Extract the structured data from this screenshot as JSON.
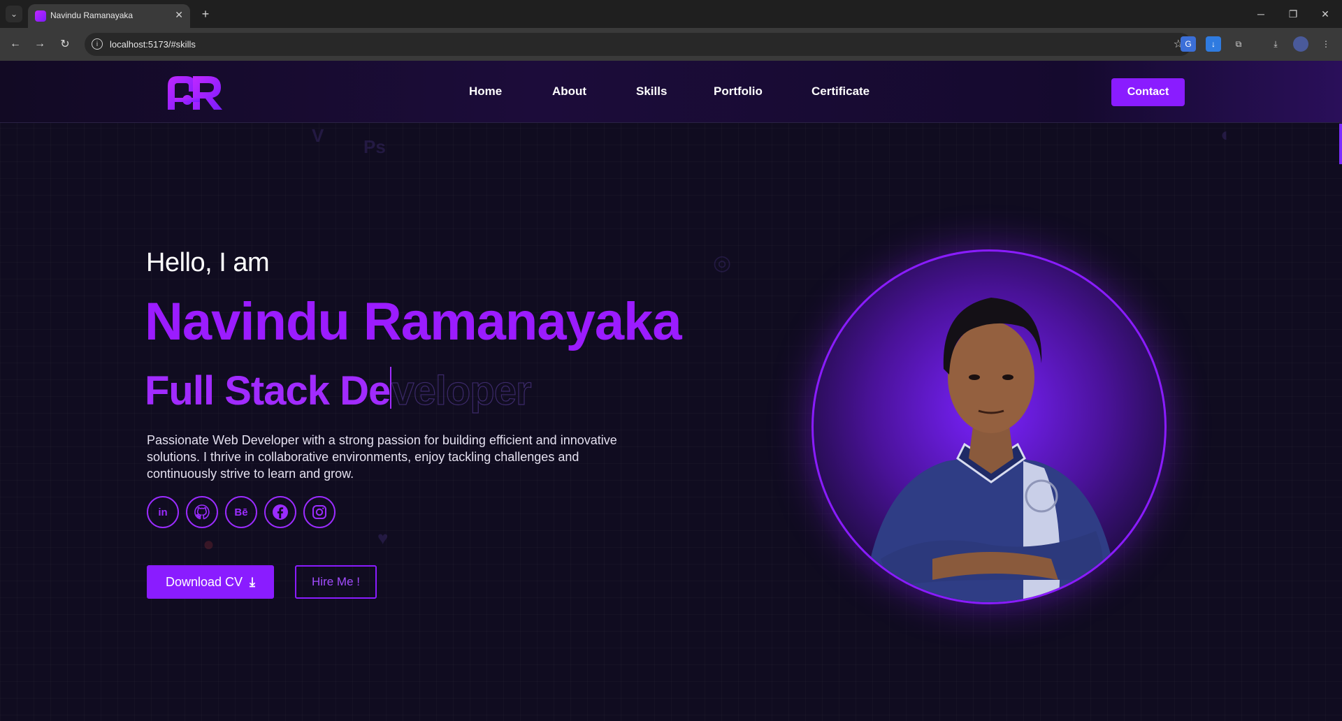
{
  "browser": {
    "tab_title": "Navindu Ramanayaka",
    "url": "localhost:5173/#skills"
  },
  "nav": {
    "links": [
      "Home",
      "About",
      "Skills",
      "Portfolio",
      "Certificate"
    ],
    "contact_label": "Contact"
  },
  "hero": {
    "greeting": "Hello, I am",
    "name": "Navindu Ramanayaka",
    "role_typed": "Full Stack De",
    "role_remaining": "veloper",
    "description": "Passionate Web Developer with a strong passion for building efficient and innovative solutions. I thrive in collaborative environments, enjoy tackling challenges and continuously strive to learn and grow.",
    "socials": [
      "linkedin-icon",
      "github-icon",
      "behance-icon",
      "facebook-icon",
      "instagram-icon"
    ],
    "download_label": "Download CV",
    "hire_label": "Hire Me !"
  },
  "colors": {
    "accent": "#8a1cff",
    "background": "#100c20"
  }
}
